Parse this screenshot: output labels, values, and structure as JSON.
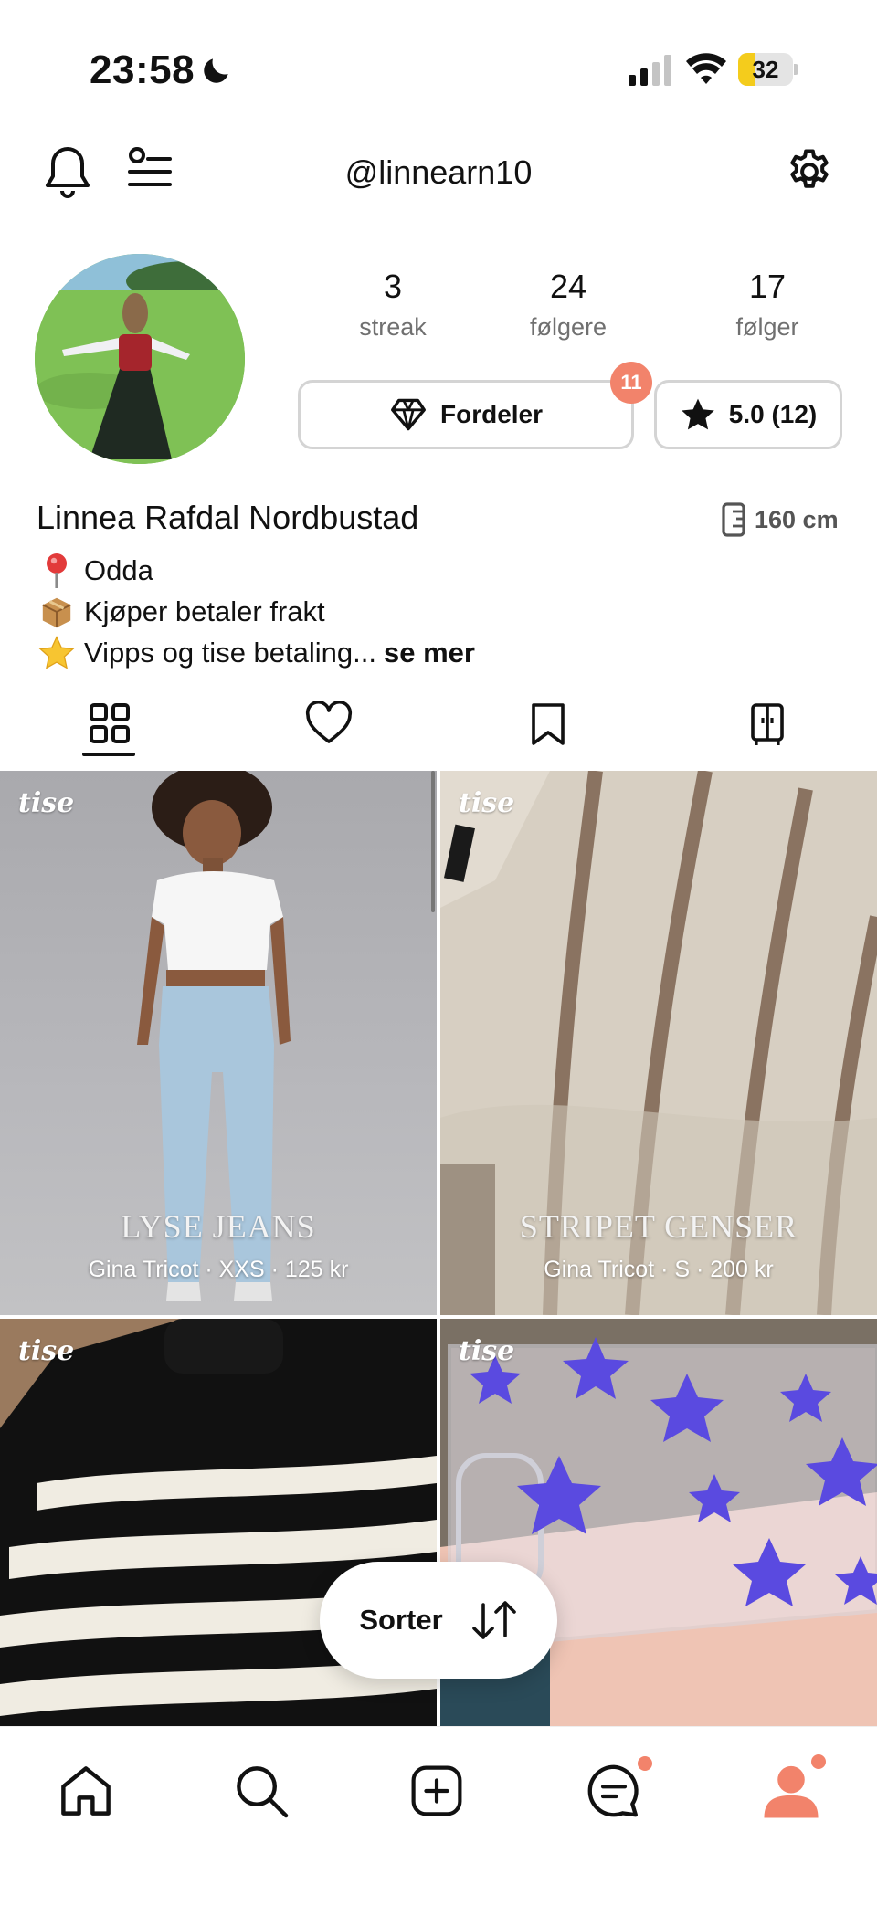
{
  "status_bar": {
    "time": "23:58",
    "battery_level": "32",
    "battery_fraction": 0.32
  },
  "header": {
    "username": "@linnearn10"
  },
  "profile": {
    "stats": [
      {
        "value": "3",
        "label": "streak"
      },
      {
        "value": "24",
        "label": "følgere"
      },
      {
        "value": "17",
        "label": "følger"
      }
    ],
    "perks_button": "Fordeler",
    "perks_badge": "11",
    "rating_button": "5.0 (12)",
    "full_name": "Linnea Rafdal Nordbustad",
    "height": "160 cm",
    "bio": [
      {
        "icon": "pin-icon",
        "text": "Odda"
      },
      {
        "icon": "package-icon",
        "text": "Kjøper betaler frakt"
      },
      {
        "icon": "star-emoji-icon",
        "text": "Vipps og tise betaling..."
      }
    ],
    "see_more": "se mer"
  },
  "tabs": [
    {
      "icon": "grid-icon",
      "active": true
    },
    {
      "icon": "heart-icon",
      "active": false
    },
    {
      "icon": "bookmark-icon",
      "active": false
    },
    {
      "icon": "wardrobe-icon",
      "active": false
    }
  ],
  "listings": [
    {
      "logo": "tise",
      "title": "LYSE JEANS",
      "subtitle": "Gina Tricot · XXS · 125 kr"
    },
    {
      "logo": "tise",
      "title": "STRIPET GENSER",
      "subtitle": "Gina Tricot · S · 200 kr"
    },
    {
      "logo": "tise",
      "title": "",
      "subtitle": ""
    },
    {
      "logo": "tise",
      "title": "",
      "subtitle": ""
    }
  ],
  "sort_button": "Sorter",
  "colors": {
    "accent": "#f2836b",
    "battery": "#f4cc1c",
    "border": "#d4d4d4",
    "muted_text": "#707070"
  },
  "bottom_nav": [
    {
      "icon": "home-icon",
      "notification": false
    },
    {
      "icon": "search-icon",
      "notification": false
    },
    {
      "icon": "add-icon",
      "notification": false
    },
    {
      "icon": "chat-icon",
      "notification": true
    },
    {
      "icon": "profile-icon",
      "notification": true,
      "active": true
    }
  ]
}
